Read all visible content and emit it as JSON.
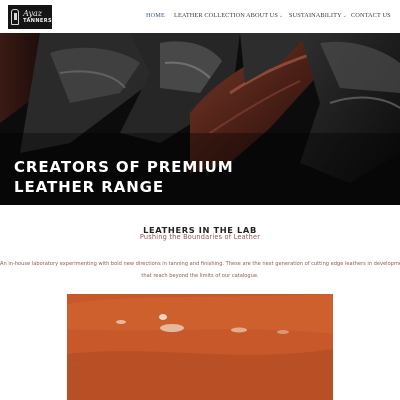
{
  "brand": {
    "logo_script": "Ayaz",
    "logo_word": "TANNERS"
  },
  "nav": {
    "items": [
      {
        "label": "HOME",
        "active": true
      },
      {
        "label": "LEATHER COLLECTION",
        "active": false
      },
      {
        "label": "ABOUT US",
        "active": false,
        "dropdown": true
      },
      {
        "label": "SUSTAINABILITY",
        "active": false,
        "dropdown": true
      },
      {
        "label": "CONTACT US",
        "active": false
      }
    ],
    "active_color": "#2f5a8a",
    "dropdown_icon": "chevron-down-icon"
  },
  "hero": {
    "title": "CREATORS OF PREMIUM\nLEATHER RANGE",
    "image": "dark quilted leather jackets"
  },
  "section": {
    "title": "LEATHERS IN THE LAB",
    "subtitle": "Pushing the Boundaries of Leather",
    "body_lines": [
      "An in-house laboratory experimenting with bold new directions in tanning and finishing. These are the next generation of cutting edge leathers in development",
      "that reach beyond the limits of our catalogue."
    ],
    "text_color": "#8a5a55"
  },
  "lab_image": {
    "image": "orange leather surface with water droplets",
    "color": "#c95a28"
  }
}
